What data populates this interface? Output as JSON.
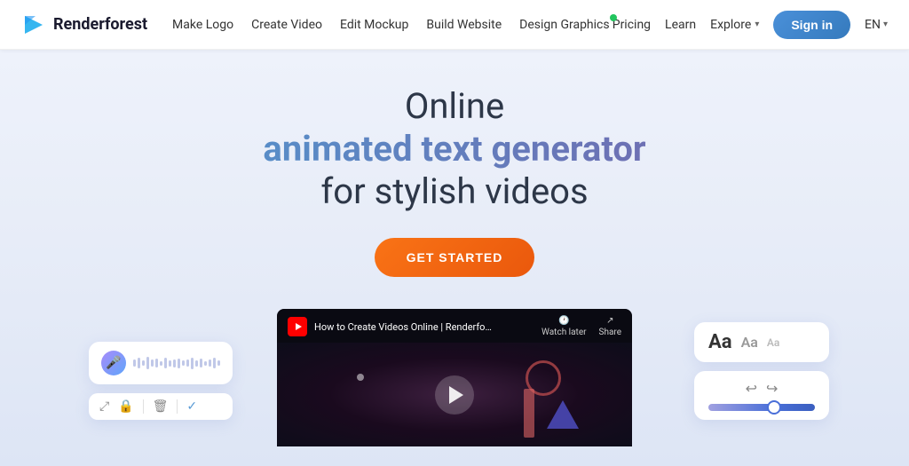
{
  "navbar": {
    "logo_text": "Renderforest",
    "nav_links": [
      {
        "label": "Make Logo",
        "id": "make-logo"
      },
      {
        "label": "Create Video",
        "id": "create-video"
      },
      {
        "label": "Edit Mockup",
        "id": "edit-mockup"
      },
      {
        "label": "Build Website",
        "id": "build-website"
      },
      {
        "label": "Design Graphics",
        "id": "design-graphics",
        "badge": true
      }
    ],
    "right_links": {
      "pricing": "Pricing",
      "learn": "Learn",
      "explore": "Explore",
      "signin": "Sign in",
      "lang": "EN"
    }
  },
  "hero": {
    "title_line1": "Online",
    "title_line2": "animated text generator",
    "title_line3": "for stylish videos",
    "cta_button": "GET STARTED"
  },
  "video": {
    "title": "How to Create Videos Online | Renderforest Tu...",
    "watch_later": "Watch later",
    "share": "Share"
  },
  "left_panel": {
    "toolbar_icons": [
      "crop",
      "lock",
      "trash",
      "check"
    ]
  },
  "right_panel": {
    "font_sizes": [
      "Aa",
      "Aa",
      "Aa"
    ]
  }
}
